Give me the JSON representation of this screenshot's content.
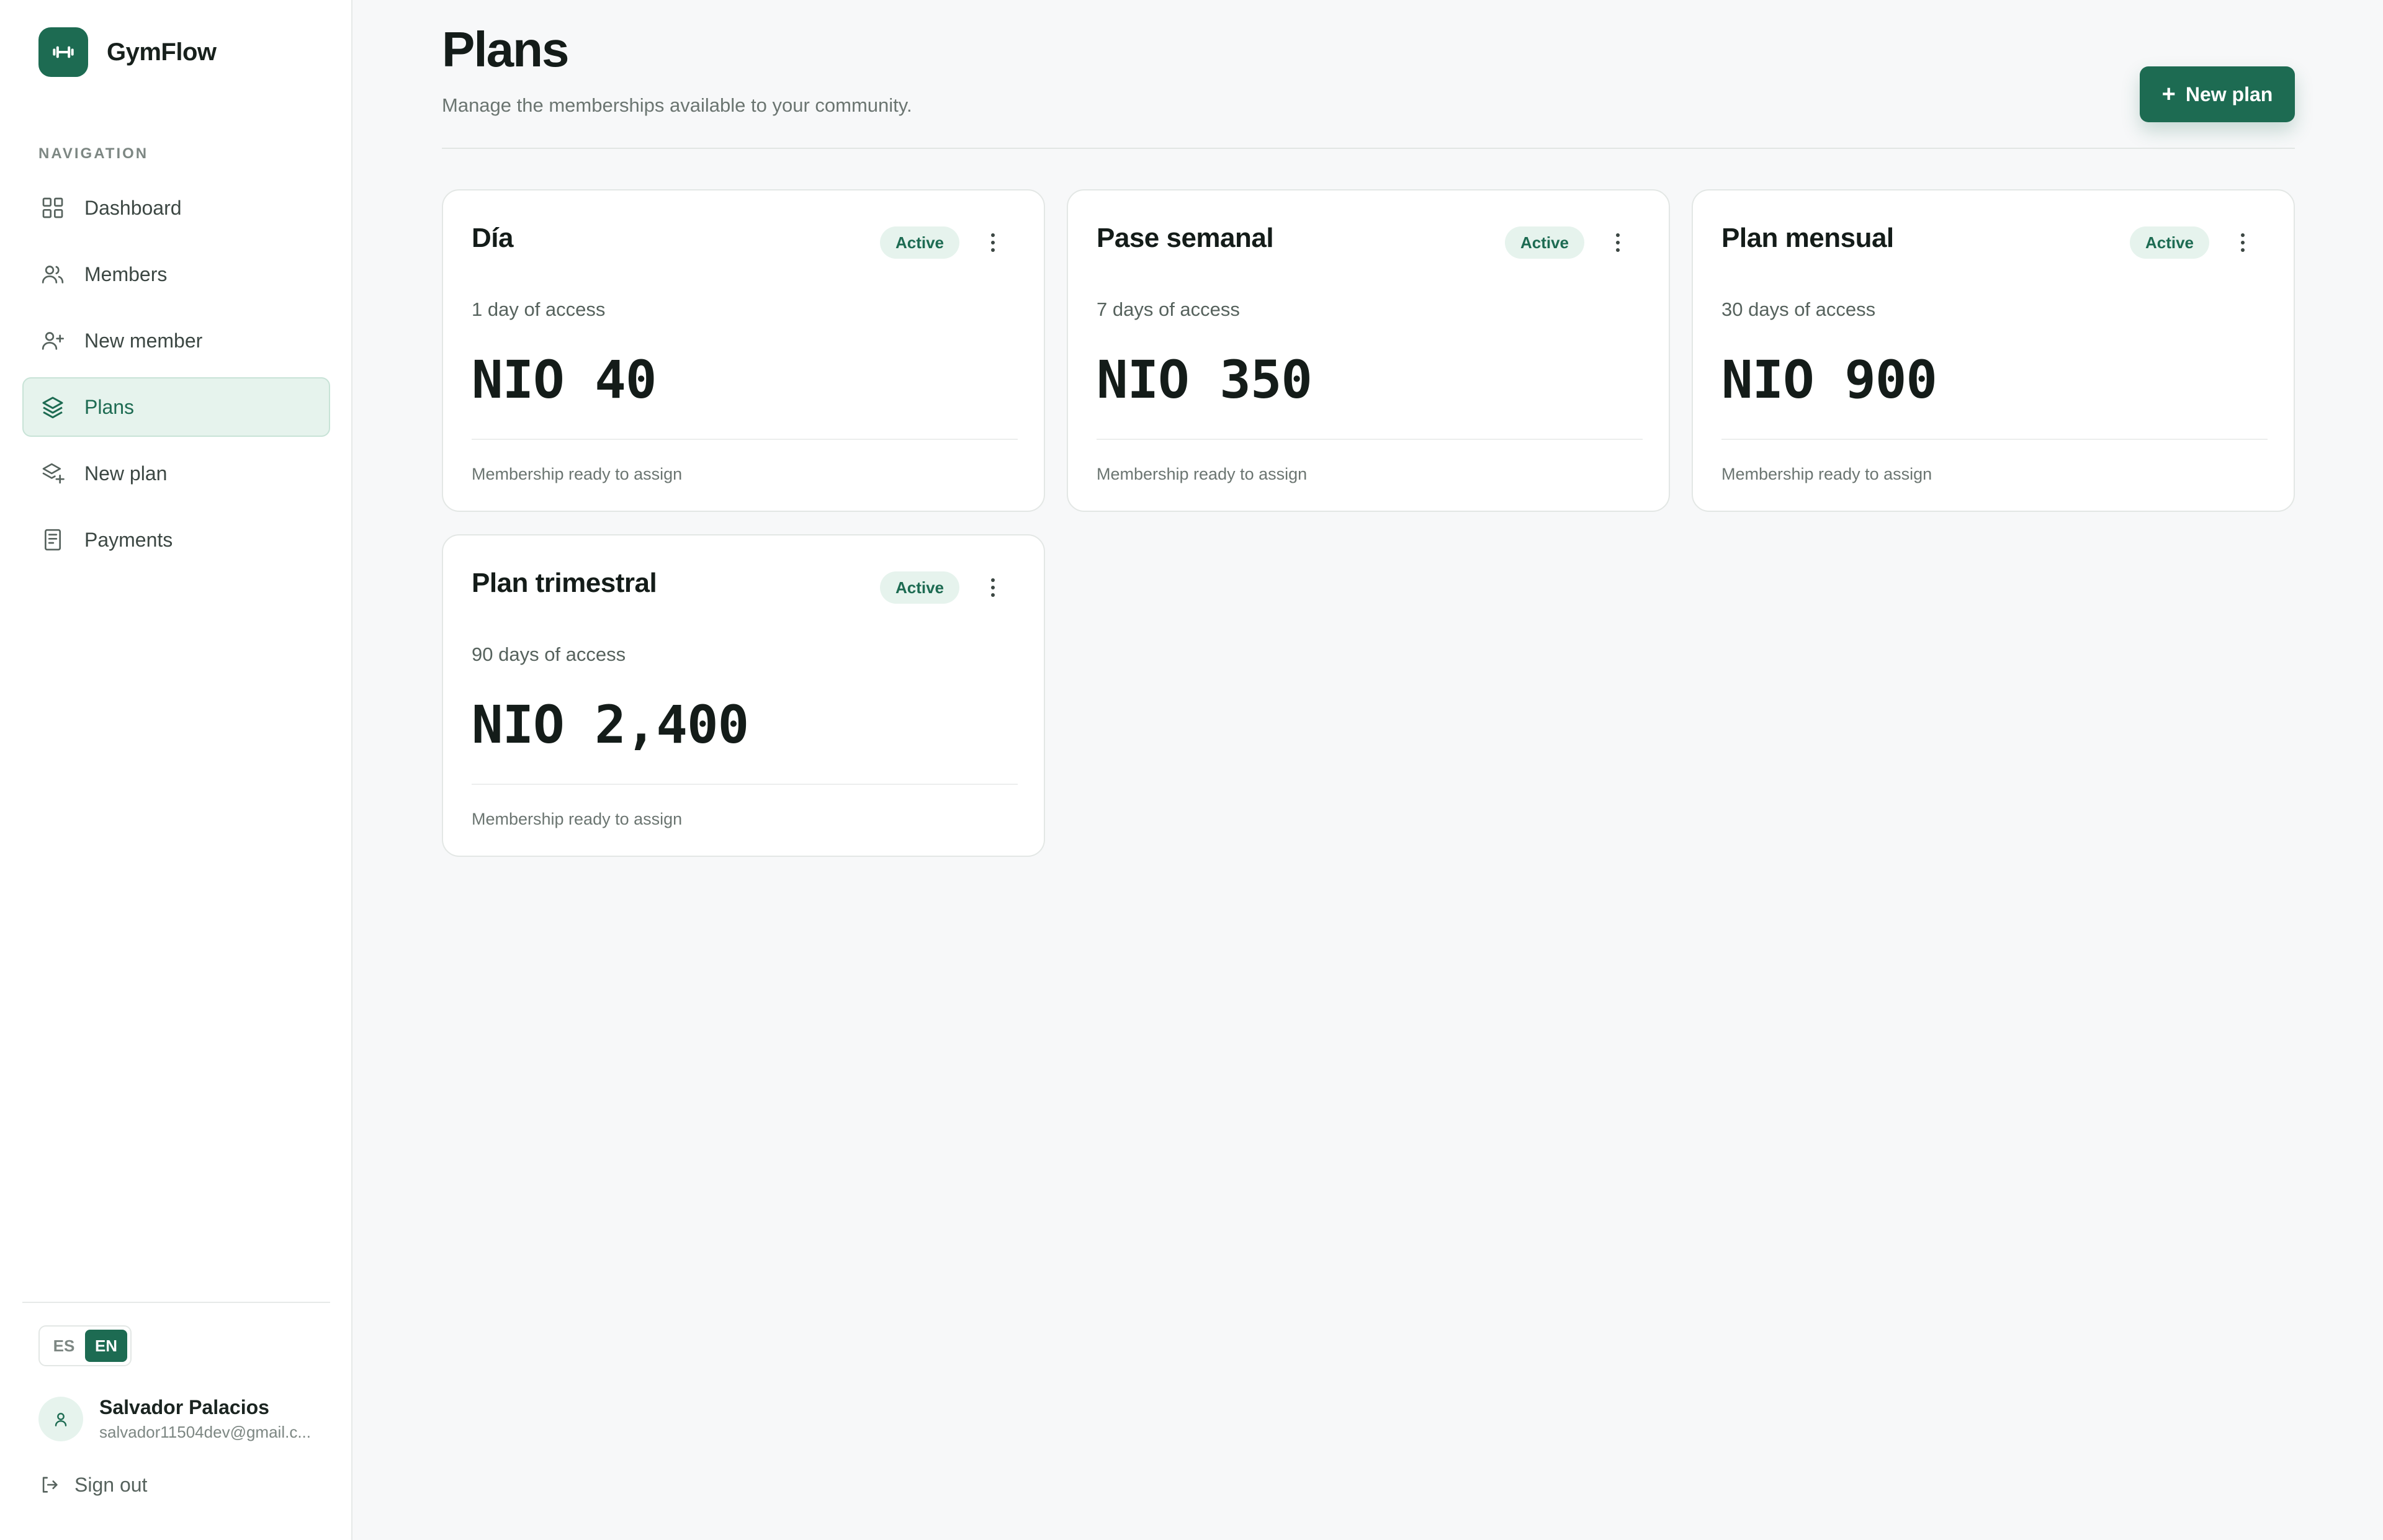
{
  "brand": {
    "name": "GymFlow",
    "logo_icon": "dumbbell-icon",
    "accent": "#1d6b52"
  },
  "sidebar": {
    "heading": "NAVIGATION",
    "items": [
      {
        "label": "Dashboard",
        "icon": "grid-icon",
        "active": false
      },
      {
        "label": "Members",
        "icon": "users-icon",
        "active": false
      },
      {
        "label": "New member",
        "icon": "user-plus-icon",
        "active": false
      },
      {
        "label": "Plans",
        "icon": "layers-icon",
        "active": true
      },
      {
        "label": "New plan",
        "icon": "layers-plus-icon",
        "active": false
      },
      {
        "label": "Payments",
        "icon": "receipt-icon",
        "active": false
      }
    ],
    "languages": {
      "es": "ES",
      "en": "EN",
      "selected": "EN"
    },
    "user": {
      "name": "Salvador Palacios",
      "email": "salvador11504dev@gmail.c..."
    },
    "sign_out": "Sign out"
  },
  "header": {
    "title": "Plans",
    "subtitle": "Manage the memberships available to your community.",
    "new_plan_button": "New plan"
  },
  "plans": [
    {
      "name": "Día",
      "status": "Active",
      "duration": "1 day of access",
      "price": "NIO 40",
      "footer": "Membership ready to assign"
    },
    {
      "name": "Pase semanal",
      "status": "Active",
      "duration": "7 days of access",
      "price": "NIO 350",
      "footer": "Membership ready to assign"
    },
    {
      "name": "Plan mensual",
      "status": "Active",
      "duration": "30 days of access",
      "price": "NIO 900",
      "footer": "Membership ready to assign"
    },
    {
      "name": "Plan trimestral",
      "status": "Active",
      "duration": "90 days of access",
      "price": "NIO 2,400",
      "footer": "Membership ready to assign"
    }
  ]
}
